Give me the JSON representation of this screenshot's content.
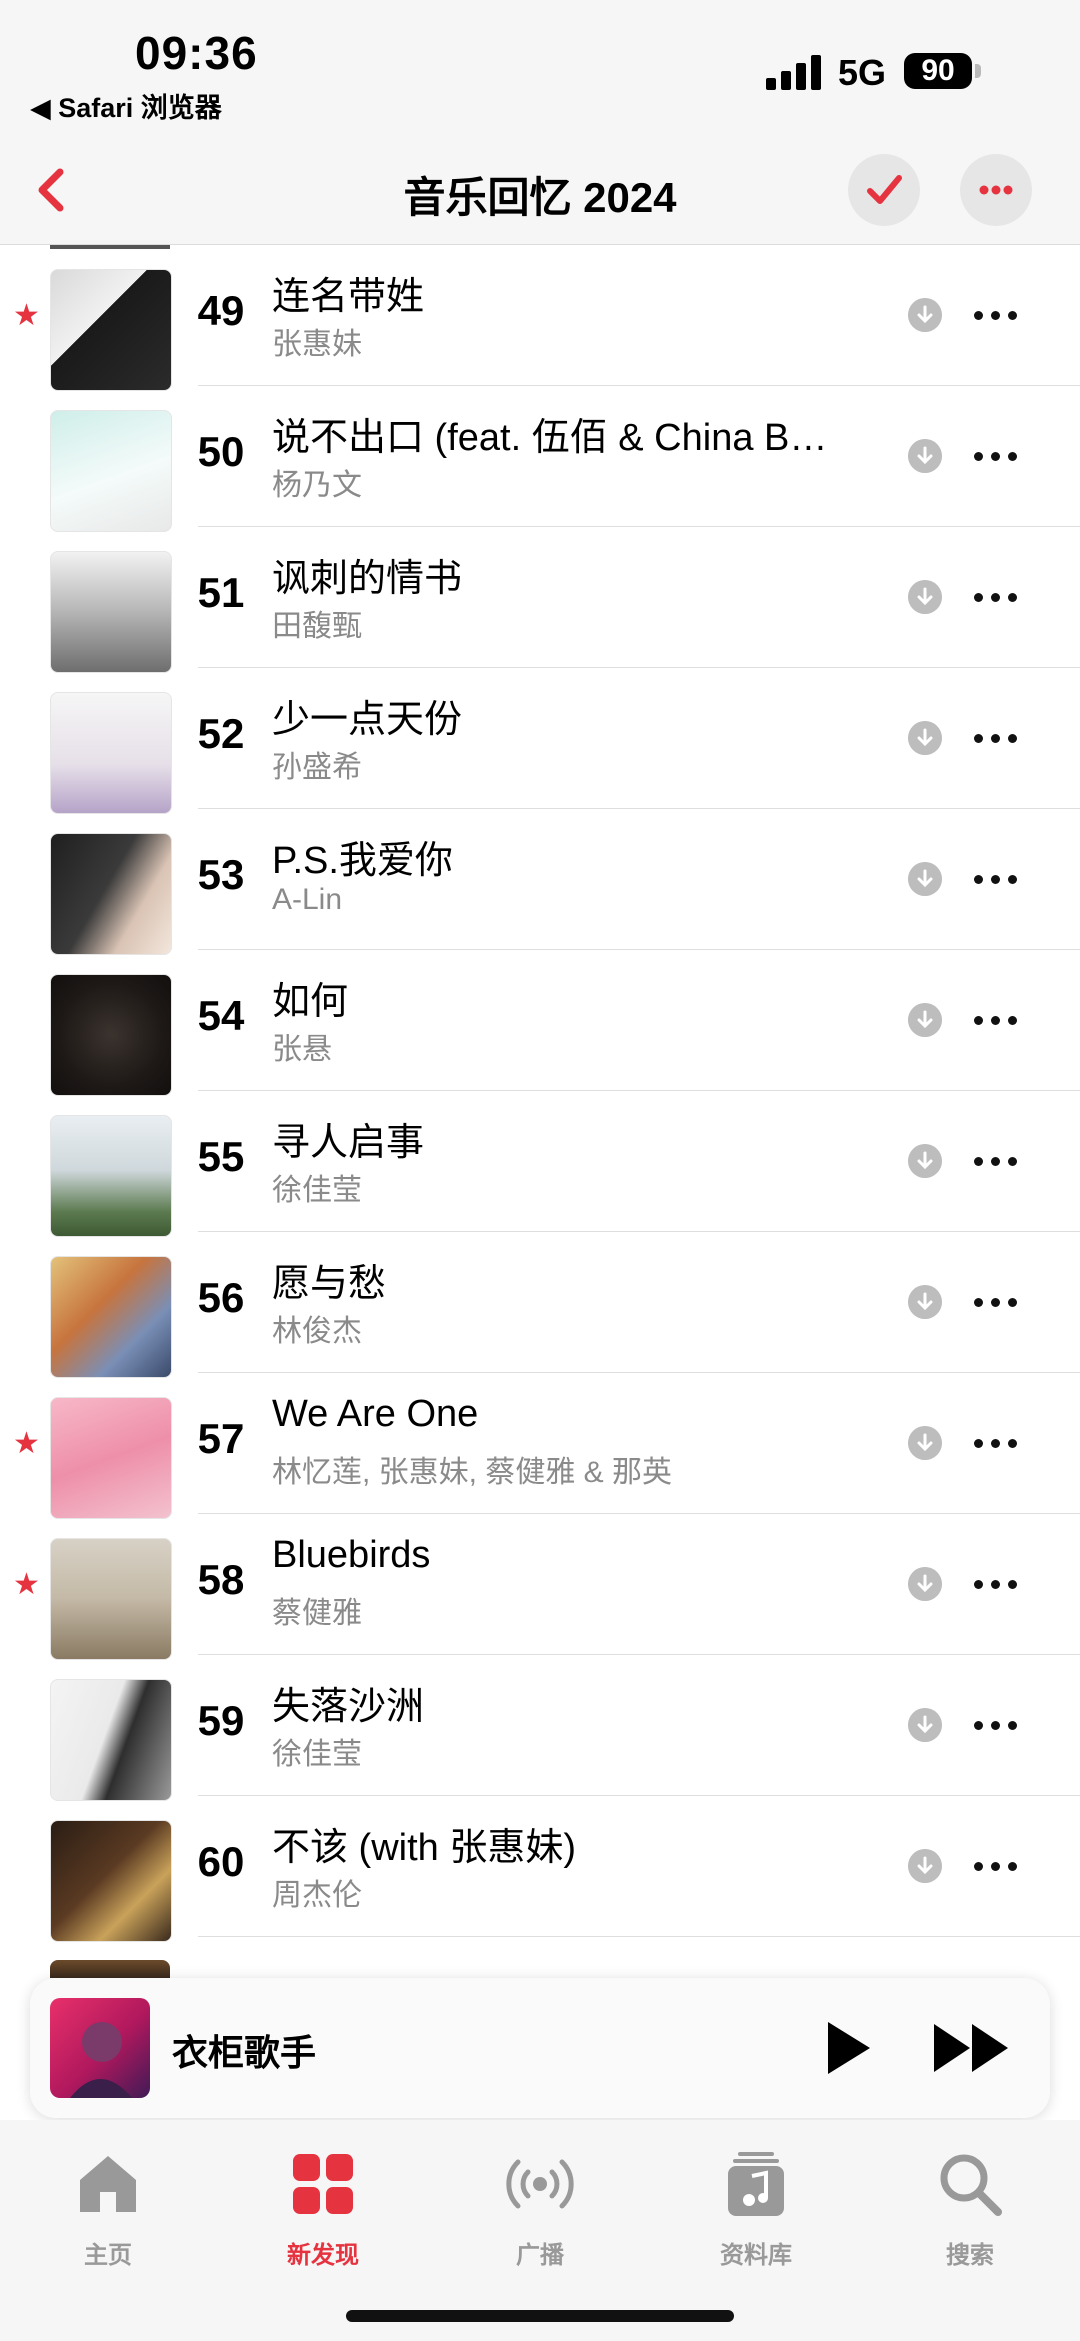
{
  "status_bar": {
    "time": "09:36",
    "back_app": "◀ Safari 浏览器",
    "network": "5G",
    "battery": "90"
  },
  "nav": {
    "title": "音乐回忆 2024",
    "accent_color": "#e5333f"
  },
  "songs": [
    {
      "rank": "49",
      "title": "连名带姓",
      "artist": "张惠妹",
      "starred": true
    },
    {
      "rank": "50",
      "title": "说不出口 (feat. 伍佰 & China B…",
      "artist": "杨乃文",
      "starred": false
    },
    {
      "rank": "51",
      "title": "讽刺的情书",
      "artist": "田馥甄",
      "starred": false
    },
    {
      "rank": "52",
      "title": "少一点天份",
      "artist": "孙盛希",
      "starred": false
    },
    {
      "rank": "53",
      "title": "P.S.我爱你",
      "artist": "A-Lin",
      "starred": false
    },
    {
      "rank": "54",
      "title": "如何",
      "artist": "张悬",
      "starred": false
    },
    {
      "rank": "55",
      "title": "寻人启事",
      "artist": "徐佳莹",
      "starred": false
    },
    {
      "rank": "56",
      "title": "愿与愁",
      "artist": "林俊杰",
      "starred": false
    },
    {
      "rank": "57",
      "title": "We Are One",
      "artist": "林忆莲, 张惠妹, 蔡健雅 & 那英",
      "starred": true
    },
    {
      "rank": "58",
      "title": "Bluebirds",
      "artist": "蔡健雅",
      "starred": true
    },
    {
      "rank": "59",
      "title": "失落沙洲",
      "artist": "徐佳莹",
      "starred": false
    },
    {
      "rank": "60",
      "title": "不该 (with 张惠妹)",
      "artist": "周杰伦",
      "starred": false
    }
  ],
  "mini_player": {
    "title": "衣柜歌手"
  },
  "tabs": [
    {
      "label": "主页",
      "icon": "home-icon",
      "active": false
    },
    {
      "label": "新发现",
      "icon": "grid-icon",
      "active": true
    },
    {
      "label": "广播",
      "icon": "radio-icon",
      "active": false
    },
    {
      "label": "资料库",
      "icon": "library-icon",
      "active": false
    },
    {
      "label": "搜索",
      "icon": "search-icon",
      "active": false
    }
  ]
}
